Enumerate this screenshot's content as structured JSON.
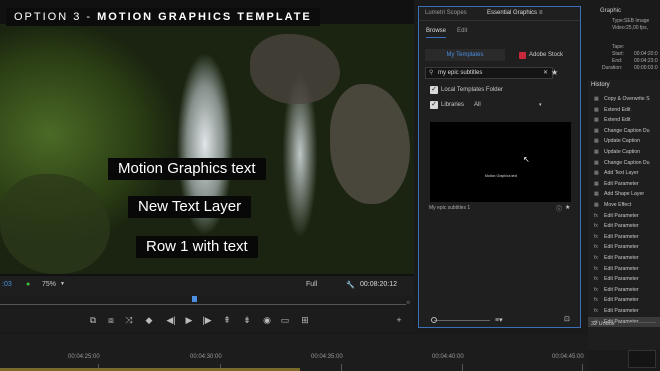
{
  "monitor": {
    "title_prefix": "OPTION 3 - ",
    "title_bold": "MOTION GRAPHICS TEMPLATE",
    "captions": [
      "Motion Graphics text",
      "New Text Layer",
      "Row 1 with text"
    ],
    "timecode_left": ":03",
    "zoom": "75%",
    "quality": "Full",
    "timecode_right": "00:08:20:12"
  },
  "essential_graphics": {
    "tabs": [
      "Lumetri Scopes",
      "Essential Graphics"
    ],
    "sub_tabs": [
      "Browse",
      "Edit"
    ],
    "my_templates": "My Templates",
    "adobe_stock": "Adobe Stock",
    "search_value": "my epic subtitles",
    "local_templates_label": "Local Templates Folder",
    "libraries_label": "Libraries",
    "libraries_value": "All",
    "preview_text": "Motion Graphics text",
    "template_name": "My epic subtitles 1"
  },
  "metadata": {
    "header": "Graphic",
    "rows": [
      {
        "label": "Type:",
        "value": "SEB Image"
      },
      {
        "label": "Video:",
        "value": "25,00 fps,"
      },
      {
        "label": "Tape:",
        "value": ""
      },
      {
        "label": "Start:",
        "value": "00:04:20:0"
      },
      {
        "label": "End:",
        "value": "00:04:23:0"
      },
      {
        "label": "Duration:",
        "value": "00:00:03:0"
      }
    ]
  },
  "history": {
    "title": "History",
    "items": [
      {
        "icon": "▦",
        "label": "Copy & Overwrite S"
      },
      {
        "icon": "▦",
        "label": "Extend Edit"
      },
      {
        "icon": "▦",
        "label": "Extend Edit"
      },
      {
        "icon": "▦",
        "label": "Change Caption Du"
      },
      {
        "icon": "▦",
        "label": "Update Caption"
      },
      {
        "icon": "▦",
        "label": "Update Caption"
      },
      {
        "icon": "▦",
        "label": "Change Caption Du"
      },
      {
        "icon": "▦",
        "label": "Add Text Layer"
      },
      {
        "icon": "▦",
        "label": "Edit Parameter"
      },
      {
        "icon": "▦",
        "label": "Add Shape Layer"
      },
      {
        "icon": "▦",
        "label": "Move Effect"
      },
      {
        "icon": "fx",
        "label": "Edit Parameter"
      },
      {
        "icon": "fx",
        "label": "Edit Parameter"
      },
      {
        "icon": "fx",
        "label": "Edit Parameter"
      },
      {
        "icon": "fx",
        "label": "Edit Parameter"
      },
      {
        "icon": "fx",
        "label": "Edit Parameter"
      },
      {
        "icon": "fx",
        "label": "Edit Parameter"
      },
      {
        "icon": "fx",
        "label": "Edit Parameter"
      },
      {
        "icon": "fx",
        "label": "Edit Parameter"
      },
      {
        "icon": "fx",
        "label": "Edit Parameter"
      },
      {
        "icon": "fx",
        "label": "Edit Parameter"
      },
      {
        "icon": "◎",
        "label": "Edit Parameter"
      }
    ],
    "undos": "32 Undos"
  },
  "timeline": {
    "ticks": [
      "00:04:25:00",
      "00:04:30:00",
      "00:04:35:00",
      "00:04:40:00",
      "00:04:45:00"
    ]
  },
  "colors": {
    "accent_blue": "#3b6fb7",
    "stock_red": "#c8283c"
  }
}
